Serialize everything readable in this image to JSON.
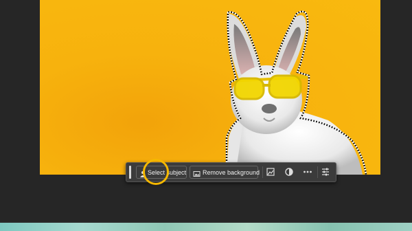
{
  "contextual_taskbar": {
    "select_subject_label": "Select subject",
    "remove_background_label": "Remove background",
    "icons": {
      "select_subject": "person-select-icon",
      "remove_background": "image-remove-bg-icon",
      "transform": "image-transform-icon",
      "mask": "mask-circle-icon",
      "more": "more-options-icon",
      "settings": "sliders-icon"
    }
  },
  "colors": {
    "highlight_ring": "#f5b800",
    "canvas_background": "#f7b20d",
    "panel_background": "#262626"
  }
}
